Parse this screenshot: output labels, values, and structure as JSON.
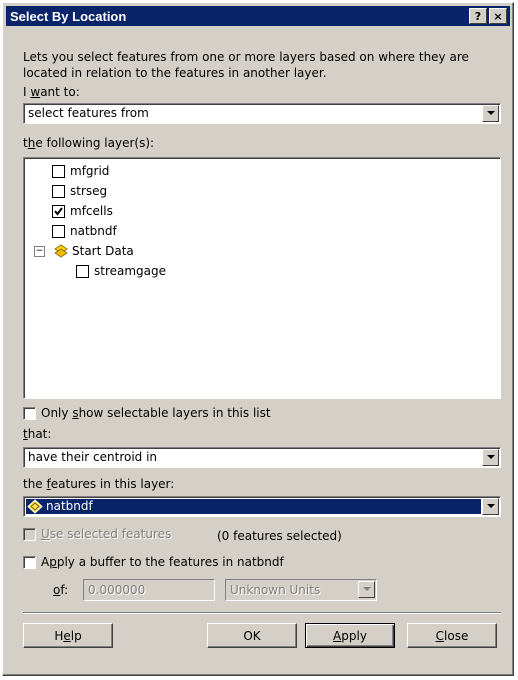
{
  "window": {
    "title": "Select By Location",
    "help_btn": "?",
    "close_btn": "×"
  },
  "description": "Lets you select features from one or more layers based on where they are located in relation to the features in another layer.",
  "i_want_to": {
    "label_pre": "I ",
    "label_ul": "w",
    "label_post": "ant to:",
    "value": "select features from"
  },
  "following_layers": {
    "label_pre": "t",
    "label_ul": "h",
    "label_post": "e following layer(s):"
  },
  "layers": [
    {
      "name": "mfgrid",
      "checked": false
    },
    {
      "name": "strseg",
      "checked": false
    },
    {
      "name": "mfcells",
      "checked": true
    },
    {
      "name": "natbndf",
      "checked": false
    }
  ],
  "group": {
    "name": "Start Data",
    "toggle": "−",
    "icon": "layer-group-icon",
    "children": [
      {
        "name": "streamgage",
        "checked": false
      }
    ]
  },
  "only_selectable": {
    "pre": "Only ",
    "ul": "s",
    "post": "how selectable layers in this list",
    "checked": false
  },
  "that": {
    "label_ul": "t",
    "label_post": "hat:",
    "value": "have their centroid in"
  },
  "features_layer": {
    "label_pre": "the ",
    "label_ul": "f",
    "label_post": "eatures in this layer:",
    "value": "natbndf"
  },
  "use_selected": {
    "ul": "U",
    "post": "se selected features",
    "checked": false,
    "count_text": "(0 features selected)"
  },
  "buffer": {
    "pre": "A",
    "ul": "p",
    "post": "ply a buffer to the features in natbndf",
    "checked": false,
    "of_ul": "o",
    "of_post": "f:",
    "value": "0.000000",
    "units": "Unknown Units"
  },
  "buttons": {
    "help_pre": "H",
    "help_ul": "e",
    "help_post": "lp",
    "ok": "OK",
    "apply_ul": "A",
    "apply_post": "pply",
    "close_ul": "C",
    "close_post": "lose"
  },
  "colors": {
    "titlebar": "#0a246a",
    "face": "#d4d0c8",
    "selection": "#0a246a"
  }
}
